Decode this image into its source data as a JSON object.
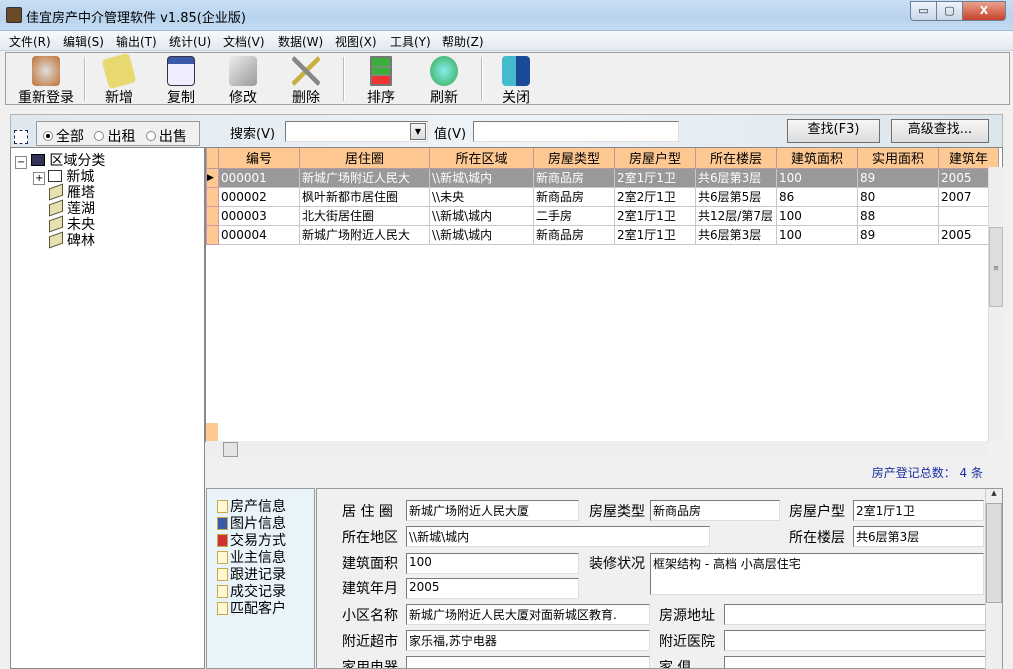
{
  "window": {
    "title": "佳宜房产中介管理软件 v1.85(企业版)",
    "minimize": "▭",
    "maximize": "▢",
    "close": "X"
  },
  "menu": [
    "文件(R)",
    "编辑(S)",
    "输出(T)",
    "统计(U)",
    "文档(V)",
    "数据(W)",
    "视图(X)",
    "工具(Y)",
    "帮助(Z)"
  ],
  "toolbar": [
    {
      "label": "重新登录",
      "icon": "relogin-icon",
      "color": "#c07030"
    },
    {
      "label": "新增",
      "icon": "add-icon",
      "color": "#e8d870"
    },
    {
      "label": "复制",
      "icon": "copy-icon",
      "color": "#3a5aa8"
    },
    {
      "label": "修改",
      "icon": "edit-icon",
      "color": "#999999"
    },
    {
      "label": "删除",
      "icon": "delete-icon",
      "color": "#c8b040"
    },
    {
      "label": "排序",
      "icon": "sort-icon",
      "color": "#3cae3c"
    },
    {
      "label": "刷新",
      "icon": "refresh-icon",
      "color": "#2fa84a"
    },
    {
      "label": "关闭",
      "icon": "exit-icon",
      "color": "#2a74c8"
    }
  ],
  "filter": {
    "options": [
      "全部",
      "出租",
      "出售"
    ],
    "selected": 0,
    "search_label": "搜索(V)",
    "search_value": "",
    "value_label": "值(V)",
    "value": "",
    "find_button": "查找(F3)",
    "advanced_button": "高级查找..."
  },
  "tree": {
    "root": "区域分类",
    "children": [
      "新城",
      "雁塔",
      "莲湖",
      "未央",
      "碑林"
    ]
  },
  "grid": {
    "columns": [
      "编号",
      "居住圈",
      "所在区域",
      "房屋类型",
      "房屋户型",
      "所在楼层",
      "建筑面积",
      "实用面积",
      "建筑年"
    ],
    "rows": [
      [
        "000001",
        "新城广场附近人民大",
        "\\\\新城\\城内",
        "新商品房",
        "2室1厅1卫",
        "共6层第3层",
        "100",
        "89",
        "2005"
      ],
      [
        "000002",
        "枫叶新都市居住圈",
        "\\\\未央",
        "新商品房",
        "2室2厅1卫",
        "共6层第5层",
        "86",
        "80",
        "2007"
      ],
      [
        "000003",
        "北大街居住圈",
        "\\\\新城\\城内",
        "二手房",
        "2室1厅1卫",
        "共12层/第7层",
        "100",
        "88",
        ""
      ],
      [
        "000004",
        "新城广场附近人民大",
        "\\\\新城\\城内",
        "新商品房",
        "2室1厅1卫",
        "共6层第3层",
        "100",
        "89",
        "2005"
      ]
    ],
    "selected_row": 0
  },
  "status": {
    "count_text": "房产登记总数： 4 条"
  },
  "nav": [
    "房产信息",
    "图片信息",
    "交易方式",
    "业主信息",
    "跟进记录",
    "成交记录",
    "匹配客户"
  ],
  "form": {
    "l_circle": "居 住 圈",
    "v_circle": "新城广场附近人民大厦",
    "l_type": "房屋类型",
    "v_type": "新商品房",
    "l_layout": "房屋户型",
    "v_layout": "2室1厅1卫",
    "l_area": "所在地区",
    "v_area": "\\\\新城\\城内",
    "l_floor": "所在楼层",
    "v_floor": "共6层第3层",
    "l_build_area": "建筑面积",
    "v_build_area": "100",
    "l_decor": "装修状况",
    "v_decor": "框架结构 - 高档 小高层住宅",
    "l_year": "建筑年月",
    "v_year": "2005",
    "l_community": "小区名称",
    "v_community": "新城广场附近人民大厦对面新城区教育.",
    "l_address": "房源地址",
    "v_address": "",
    "l_market": "附近超市",
    "v_market": "家乐福,苏宁电器",
    "l_hospital": "附近医院",
    "v_hospital": "",
    "l_appliance": "家用电器",
    "v_appliance": "",
    "l_furniture": "家 俱",
    "v_furniture": ""
  }
}
